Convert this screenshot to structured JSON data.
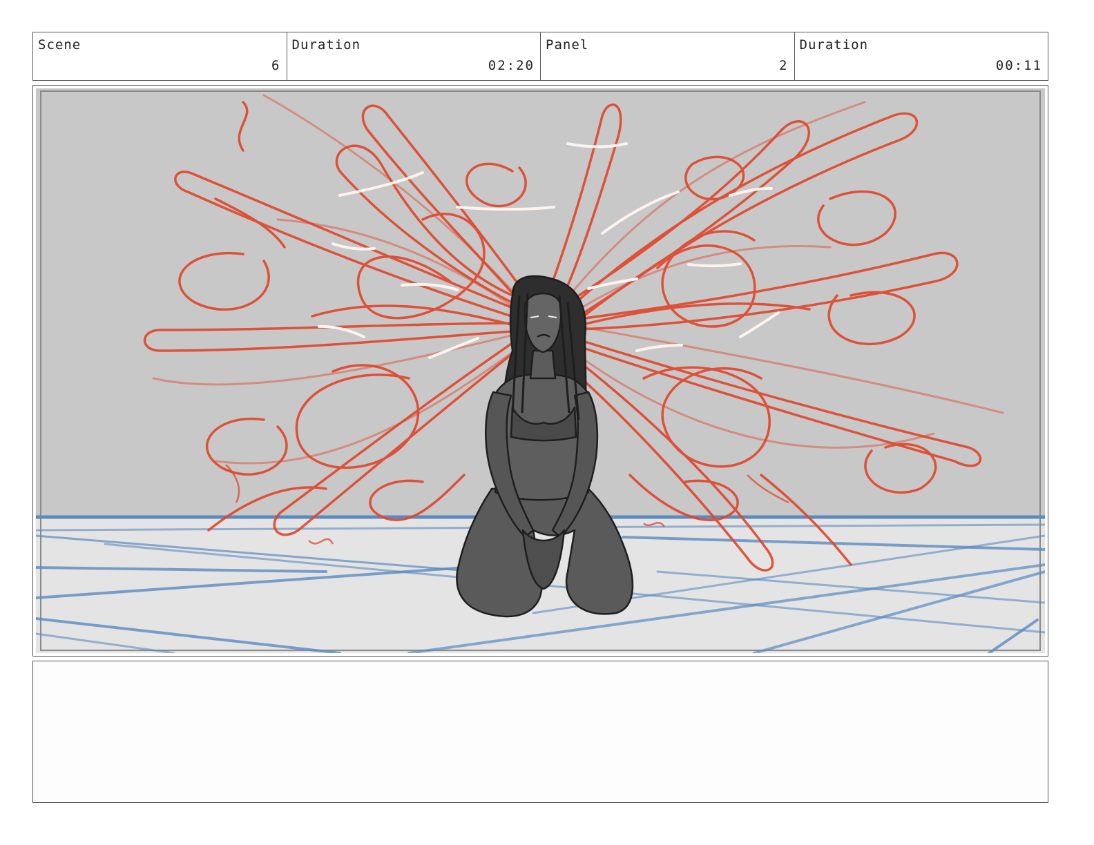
{
  "header": {
    "scene_label": "Scene",
    "scene_value": "6",
    "scene_duration_label": "Duration",
    "scene_duration_value": "02:20",
    "panel_label": "Panel",
    "panel_value": "2",
    "panel_duration_label": "Duration",
    "panel_duration_value": "00:11"
  },
  "notes": {
    "text": ""
  },
  "colors": {
    "wall": "#c8c8c8",
    "floor": "#e4e4e4",
    "grid_lines": "#5b8ac0",
    "energy_strokes": "#e0452a",
    "figure": "#5a5a5a",
    "border": "#555555"
  }
}
